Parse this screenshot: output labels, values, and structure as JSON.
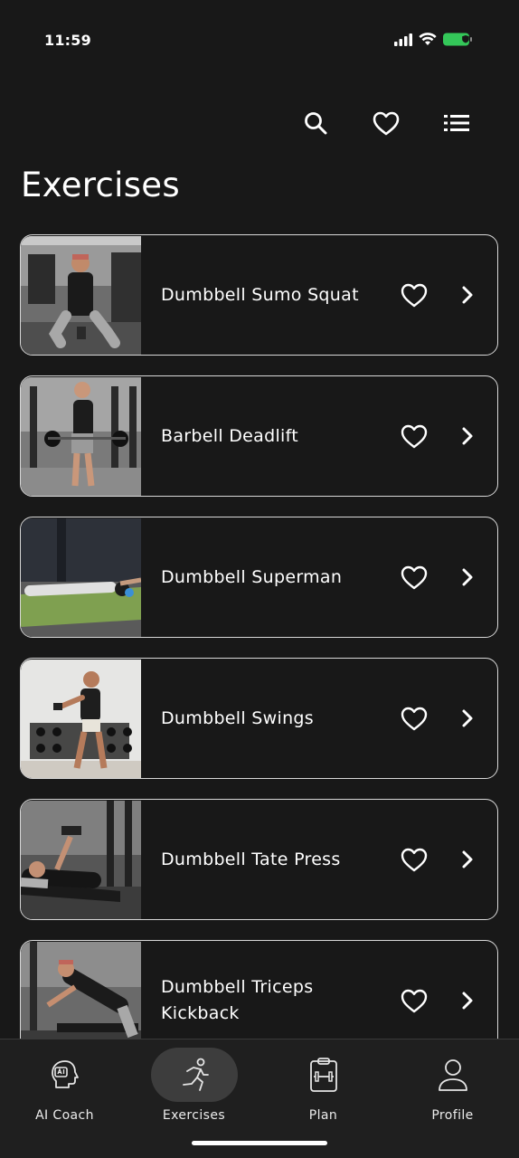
{
  "status_bar": {
    "time": "11:59",
    "icons": [
      "signal-icon",
      "wifi-icon",
      "battery-icon"
    ],
    "battery_color": "#34c759"
  },
  "header": {
    "actions": [
      "search-icon",
      "heart-icon",
      "list-icon"
    ],
    "title": "Exercises"
  },
  "exercises": [
    {
      "name": "Dumbbell Sumo Squat",
      "favorite": false
    },
    {
      "name": "Barbell Deadlift",
      "favorite": false
    },
    {
      "name": "Dumbbell Superman",
      "favorite": false
    },
    {
      "name": "Dumbbell Swings",
      "favorite": false
    },
    {
      "name": "Dumbbell Tate Press",
      "favorite": false
    },
    {
      "name": "Dumbbell Triceps Kickback",
      "favorite": false
    }
  ],
  "tabbar": {
    "tabs": [
      {
        "label": "AI Coach",
        "icon": "ai-coach-icon",
        "active": false
      },
      {
        "label": "Exercises",
        "icon": "running-person-icon",
        "active": true
      },
      {
        "label": "Plan",
        "icon": "clipboard-dumbbell-icon",
        "active": false
      },
      {
        "label": "Profile",
        "icon": "person-icon",
        "active": false
      }
    ]
  },
  "colors": {
    "background": "#181818",
    "card_border": "#d8d8d8",
    "tabbar_bg": "#1f1f1f",
    "active_tab_bg": "#3d3d3d"
  }
}
